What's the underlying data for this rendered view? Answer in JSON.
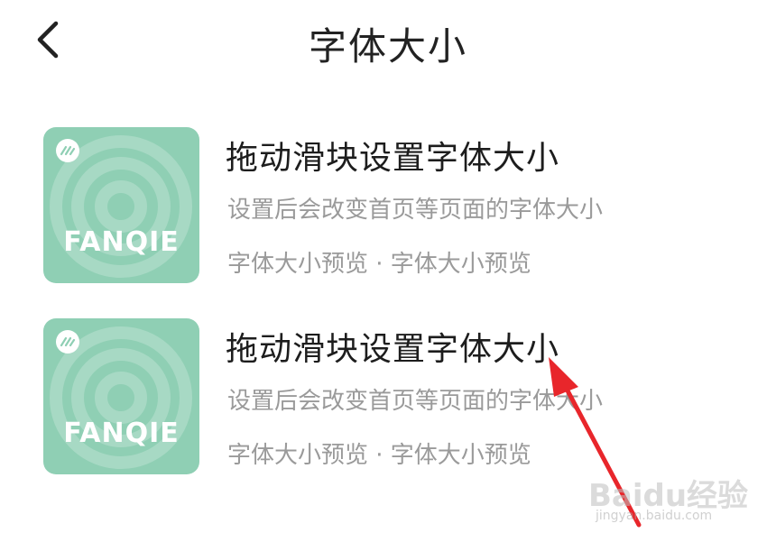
{
  "header": {
    "title": "字体大小",
    "back_icon": "chevron-left-icon"
  },
  "cards": [
    {
      "cover_text": "FANQIE",
      "title": "拖动滑块设置字体大小",
      "description": "设置后会改变首页等页面的字体大小",
      "meta": "字体大小预览 · 字体大小预览"
    },
    {
      "cover_text": "FANQIE",
      "title": "拖动滑块设置字体大小",
      "description": "设置后会改变首页等页面的字体大小",
      "meta": "字体大小预览 · 字体大小预览"
    }
  ],
  "watermark": {
    "brand": "Baidu经验",
    "url": "jingyan.baidu.com"
  },
  "colors": {
    "cover": "#8fcfb4",
    "arrow": "#e8262b",
    "title_text": "#1d1d1d",
    "secondary_text": "#9a9a9a"
  }
}
